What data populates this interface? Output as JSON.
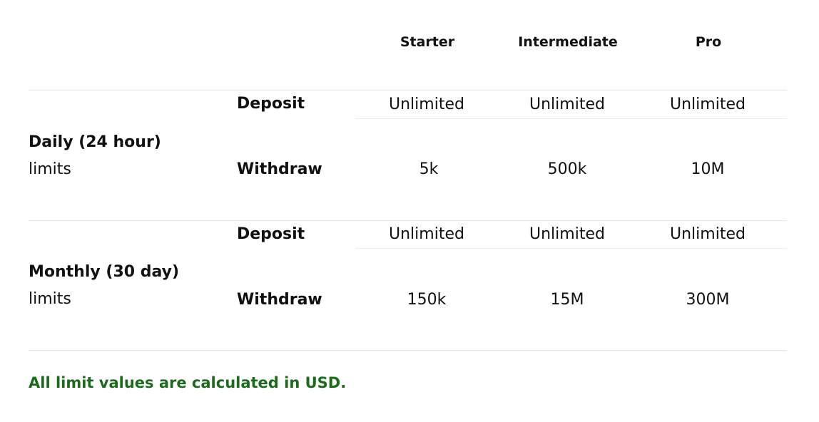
{
  "columns": [
    "Starter",
    "Intermediate",
    "Pro"
  ],
  "groups": [
    {
      "title": "Daily (24 hour)",
      "subtitle": "limits",
      "rows": [
        {
          "label": "Deposit",
          "values": [
            "Unlimited",
            "Unlimited",
            "Unlimited"
          ]
        },
        {
          "label": "Withdraw",
          "values": [
            "5k",
            "500k",
            "10M"
          ]
        }
      ]
    },
    {
      "title": "Monthly (30 day)",
      "subtitle": "limits",
      "rows": [
        {
          "label": "Deposit",
          "values": [
            "Unlimited",
            "Unlimited",
            "Unlimited"
          ]
        },
        {
          "label": "Withdraw",
          "values": [
            "150k",
            "15M",
            "300M"
          ]
        }
      ]
    }
  ],
  "footnote": "All limit values are calculated in USD.",
  "colors": {
    "text": "#111111",
    "footnote": "#1a6b1a",
    "divider": "#e8e8e8"
  }
}
